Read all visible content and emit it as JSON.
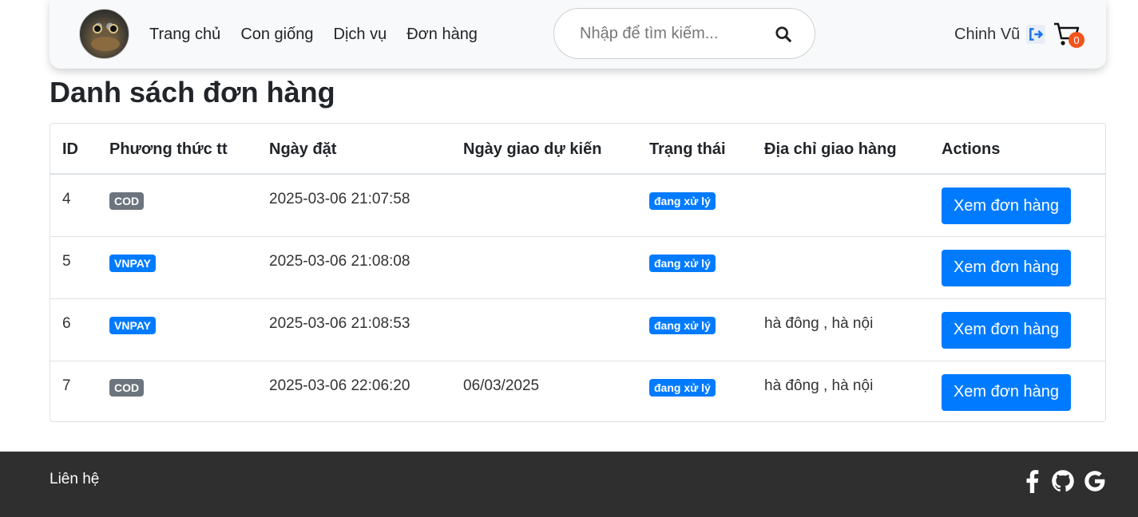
{
  "header": {
    "nav": [
      "Trang chủ",
      "Con giống",
      "Dịch vụ",
      "Đơn hàng"
    ],
    "search_placeholder": "Nhập để tìm kiếm...",
    "user_name": "Chinh Vũ",
    "cart_count": "0"
  },
  "page": {
    "title": "Danh sách đơn hàng"
  },
  "table": {
    "headers": [
      "ID",
      "Phương thức tt",
      "Ngày đặt",
      "Ngày giao dự kiến",
      "Trạng thái",
      "Địa chỉ giao hàng",
      "Actions"
    ],
    "rows": [
      {
        "id": "4",
        "payment": "COD",
        "payment_color": "#6c757d",
        "order_date": "2025-03-06 21:07:58",
        "delivery_date": "",
        "status": "đang xử lý",
        "address": "",
        "action": "Xem đơn hàng"
      },
      {
        "id": "5",
        "payment": "VNPAY",
        "payment_color": "#007bff",
        "order_date": "2025-03-06 21:08:08",
        "delivery_date": "",
        "status": "đang xử lý",
        "address": "",
        "action": "Xem đơn hàng"
      },
      {
        "id": "6",
        "payment": "VNPAY",
        "payment_color": "#007bff",
        "order_date": "2025-03-06 21:08:53",
        "delivery_date": "",
        "status": "đang xử lý",
        "address": "hà đông , hà nội",
        "action": "Xem đơn hàng"
      },
      {
        "id": "7",
        "payment": "COD",
        "payment_color": "#6c757d",
        "order_date": "2025-03-06 22:06:20",
        "delivery_date": "06/03/2025",
        "status": "đang xử lý",
        "address": "hà đông , hà nội",
        "action": "Xem đơn hàng"
      }
    ]
  },
  "footer": {
    "contact": "Liên hệ",
    "icons": [
      "facebook-icon",
      "github-icon",
      "google-icon"
    ]
  },
  "colors": {
    "primary": "#007bff",
    "secondary": "#6c757d",
    "footer_bg": "#2f2f2f",
    "cart_badge": "#f2541b"
  }
}
